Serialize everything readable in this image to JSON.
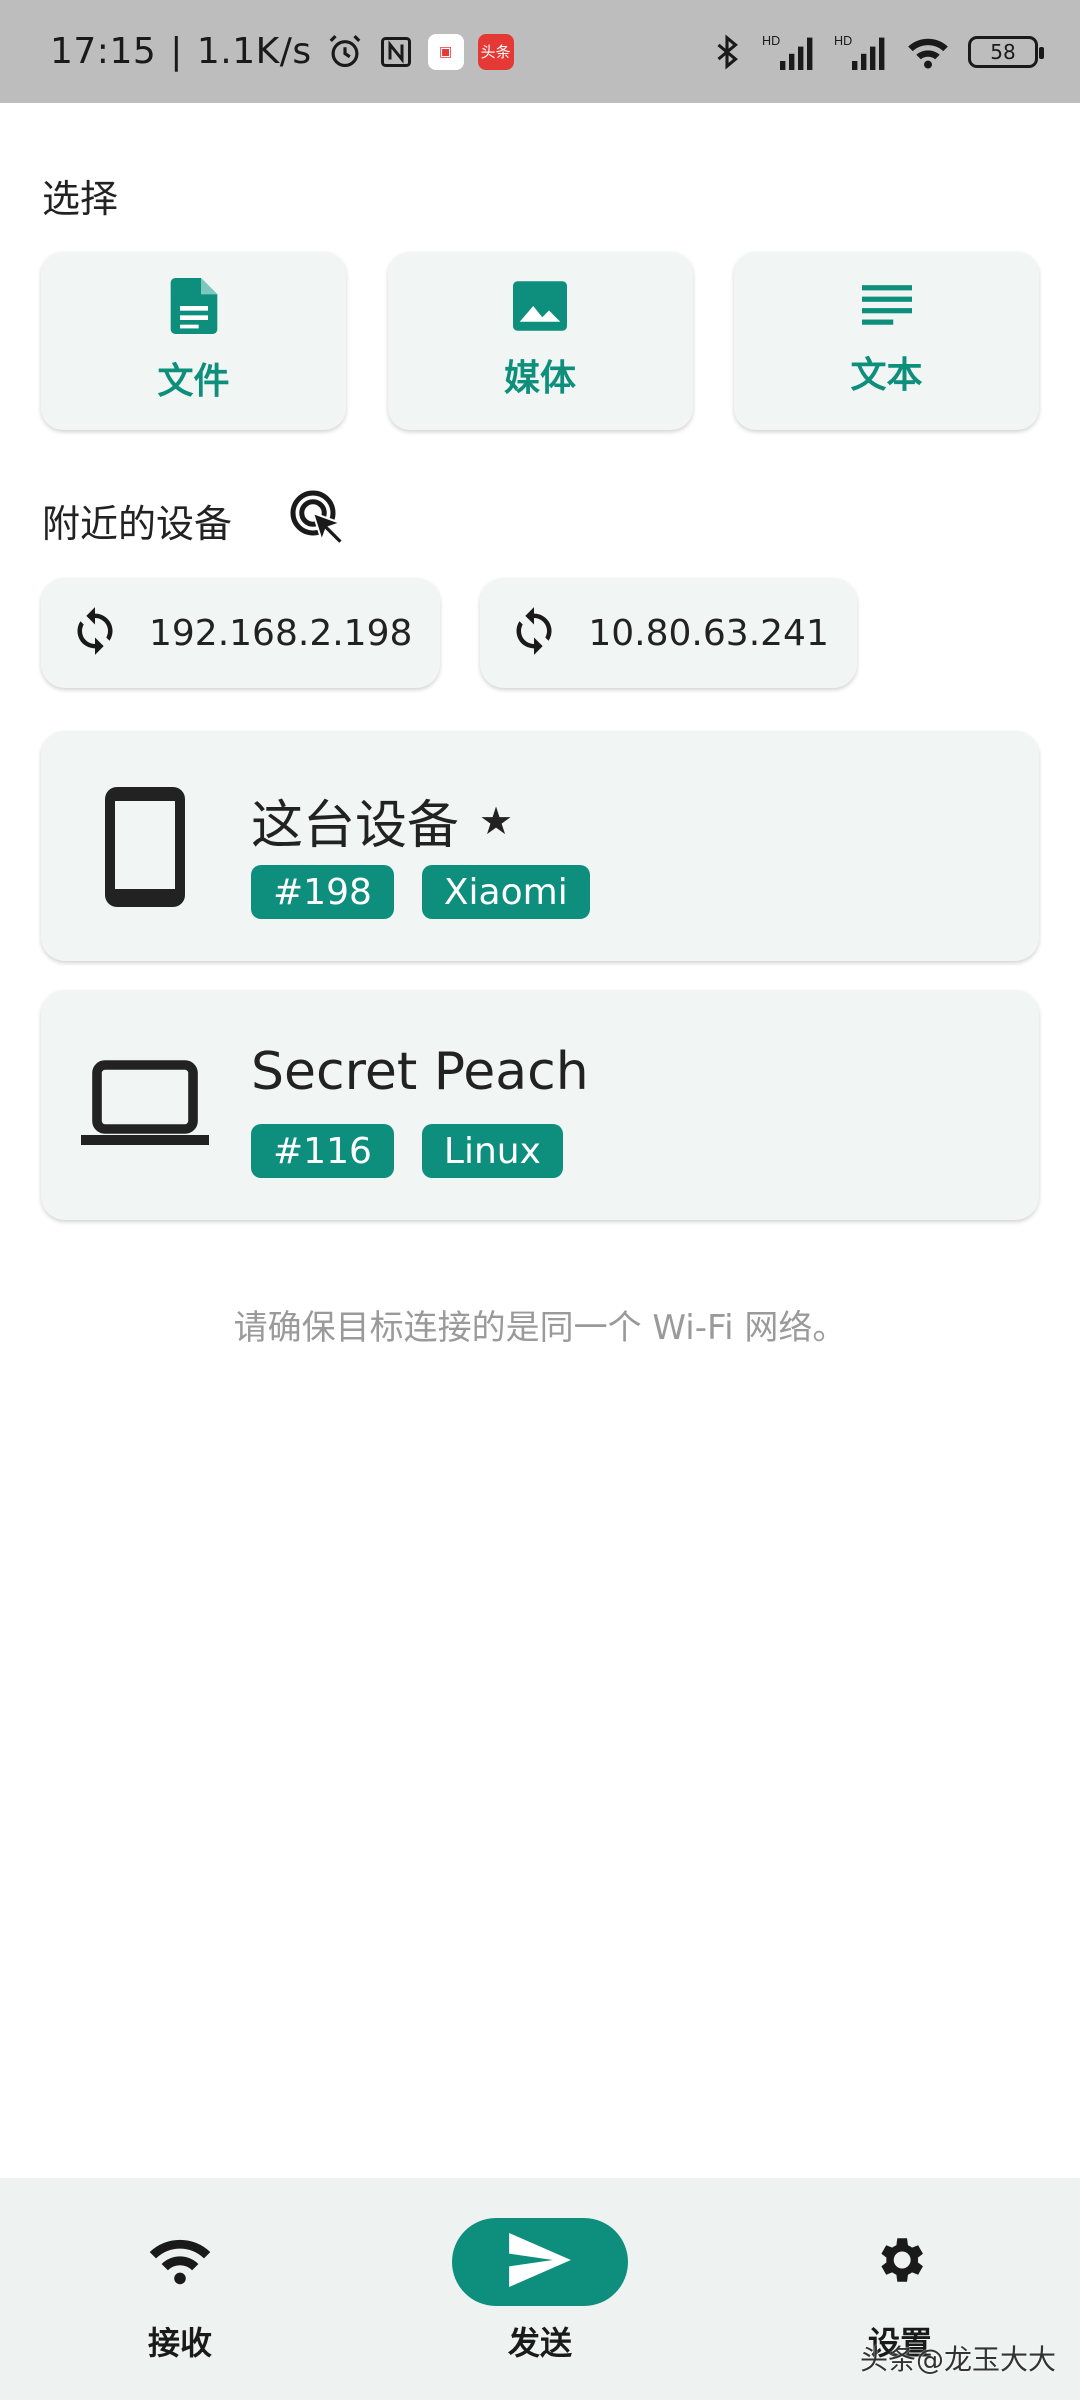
{
  "status_bar": {
    "time": "17:15",
    "separator": "|",
    "net_speed": "1.1K/s",
    "app_badge_1": "▣",
    "app_badge_2": "头条",
    "battery": "58"
  },
  "select": {
    "title": "选择",
    "items": [
      {
        "label": "文件",
        "icon": "file-icon"
      },
      {
        "label": "媒体",
        "icon": "image-icon"
      },
      {
        "label": "文本",
        "icon": "text-icon"
      }
    ]
  },
  "nearby": {
    "title": "附近的设备",
    "ips": [
      "192.168.2.198",
      "10.80.63.241"
    ],
    "devices": [
      {
        "name": "这台设备",
        "star": "★",
        "tags": [
          "#198",
          "Xiaomi"
        ],
        "icon": "phone-icon"
      },
      {
        "name": "Secret Peach",
        "tags": [
          "#116",
          "Linux"
        ],
        "icon": "laptop-icon"
      }
    ]
  },
  "hint": "请确保目标连接的是同一个 Wi-Fi 网络。",
  "bottom_nav": {
    "items": [
      {
        "label": "接收",
        "icon": "wifi-icon"
      },
      {
        "label": "发送",
        "icon": "send-icon"
      },
      {
        "label": "设置",
        "icon": "gear-icon"
      }
    ]
  },
  "watermark": "头条@龙玉大大",
  "colors": {
    "accent": "#0e8f7e",
    "card_bg": "#f1f6f5",
    "status_bar": "#bdbdbd"
  }
}
